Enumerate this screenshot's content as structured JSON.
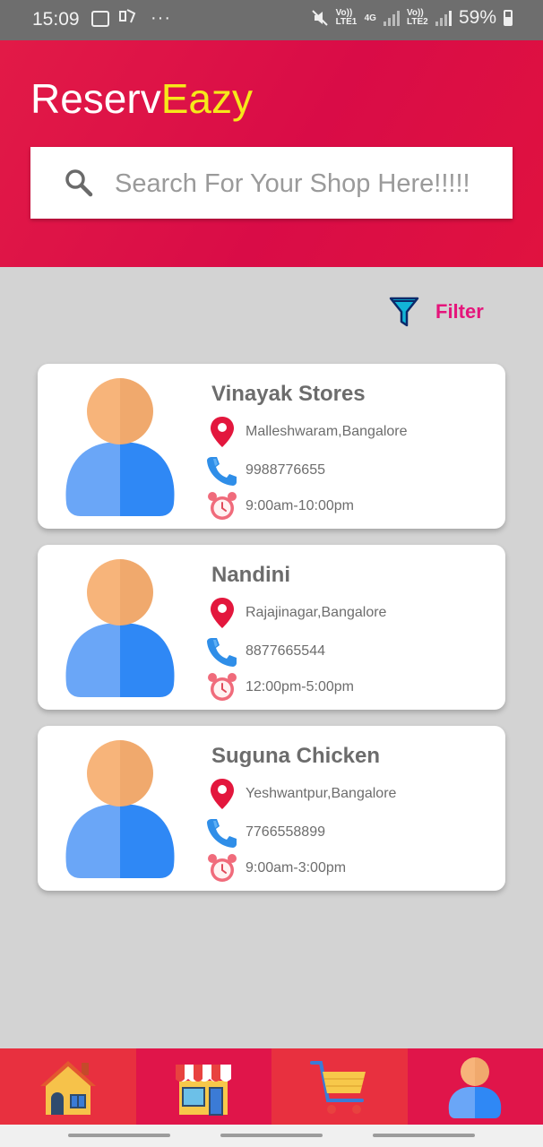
{
  "status_bar": {
    "time": "15:09",
    "left_icons": [
      "gallery-icon",
      "paytm-icon",
      "more-dots-icon"
    ],
    "sim1_label": "Vo)) LTE1",
    "network": "4G",
    "sim2_label": "Vo)) LTE2",
    "battery": "59%"
  },
  "app": {
    "brand_part1": "Reserv",
    "brand_part2": "Eazy",
    "brand_colors": {
      "part1": "#ffffff",
      "part2": "#f6e81a"
    },
    "header_color": "#dc1046"
  },
  "search": {
    "placeholder": "Search For Your Shop Here!!!!!",
    "value": ""
  },
  "filter": {
    "label": "Filter",
    "icon": "funnel-icon",
    "color": "#e5157b"
  },
  "shops": [
    {
      "name": "Vinayak Stores",
      "location": "Malleshwaram,Bangalore",
      "phone": "9988776655",
      "hours": "9:00am-10:00pm"
    },
    {
      "name": "Nandini",
      "location": "Rajajinagar,Bangalore",
      "phone": "8877665544",
      "hours": "12:00pm-5:00pm"
    },
    {
      "name": "Suguna Chicken",
      "location": "Yeshwantpur,Bangalore",
      "phone": "7766558899",
      "hours": "9:00am-3:00pm"
    }
  ],
  "bottom_nav": [
    {
      "icon": "home-icon"
    },
    {
      "icon": "shop-icon"
    },
    {
      "icon": "cart-icon"
    },
    {
      "icon": "profile-icon"
    }
  ]
}
